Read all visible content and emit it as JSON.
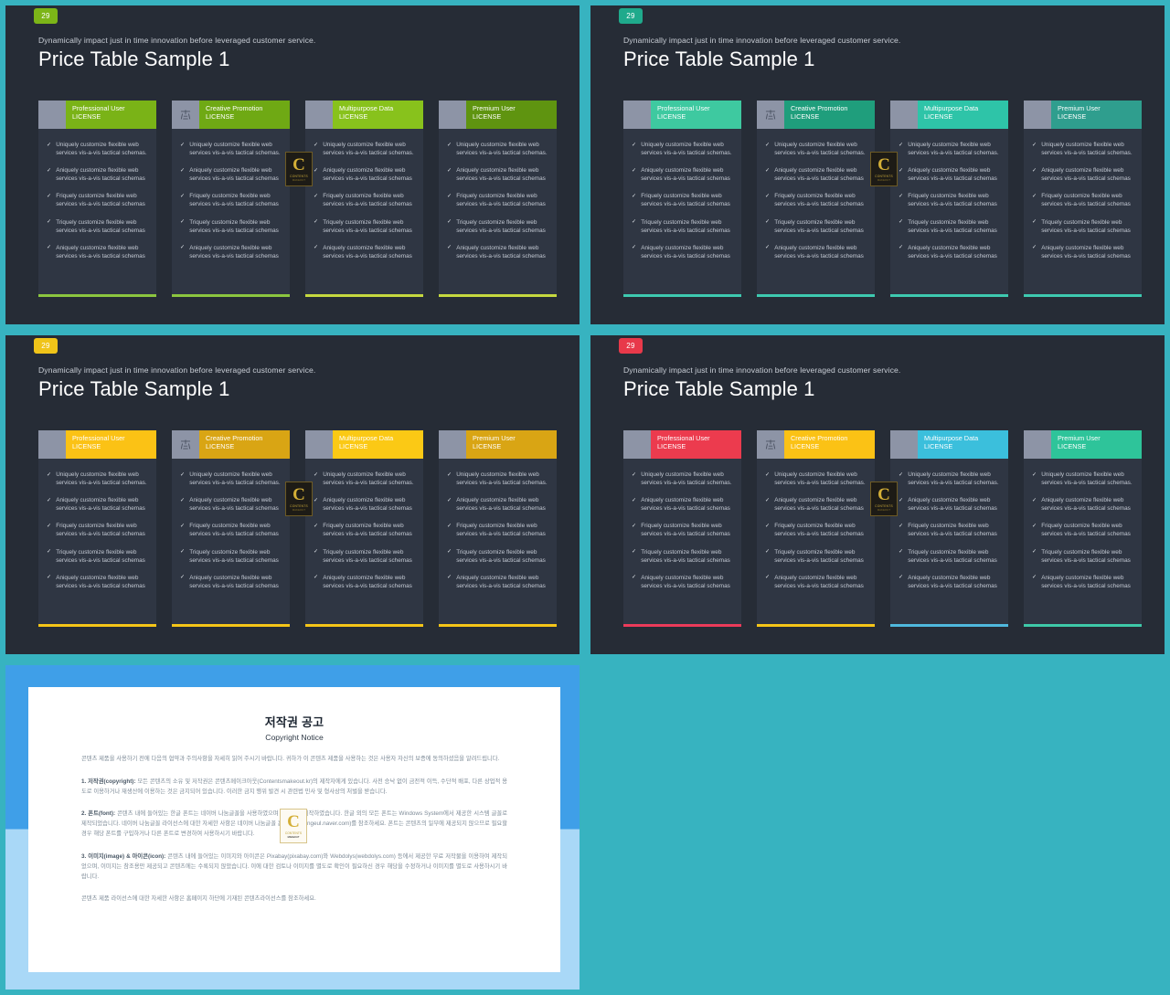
{
  "slides": [
    {
      "badge": {
        "text": "29",
        "color": "#7cb518"
      },
      "kicker": "Dynamically impact just in time innovation  before leveraged customer service.",
      "headline": "Price Table Sample 1",
      "accent_palette": [
        "#7ab317",
        "#6fa914",
        "#88c21c",
        "#5f9410"
      ],
      "rule_palette": [
        "#8cc63f",
        "#8cc63f",
        "#c6d93f",
        "#c6d93f"
      ],
      "cards": [
        {
          "title": "Professional User",
          "subtitle": "LICENSE",
          "icon": "abstract-glyph-icon",
          "icon_visible": false,
          "header_color": "#7ab317",
          "rule_color": "#8cc63f"
        },
        {
          "title": "Creative Promotion",
          "subtitle": "LICENSE",
          "icon": "abstract-glyph-icon",
          "icon_visible": true,
          "header_color": "#6fa914",
          "rule_color": "#8cc63f"
        },
        {
          "title": "Multipurpose Data",
          "subtitle": "LICENSE",
          "icon": "abstract-glyph-icon",
          "icon_visible": false,
          "header_color": "#88c21c",
          "rule_color": "#c6d93f"
        },
        {
          "title": "Premium User",
          "subtitle": "LICENSE",
          "icon": "abstract-glyph-icon",
          "icon_visible": false,
          "header_color": "#5f9410",
          "rule_color": "#c6d93f"
        }
      ]
    },
    {
      "badge": {
        "text": "29",
        "color": "#1faa8c"
      },
      "kicker": "Dynamically impact just in time innovation  before leveraged customer service.",
      "headline": "Price Table Sample 1",
      "accent_palette": [
        "#3ec9a0",
        "#1f9e7c",
        "#2ec4a8",
        "#2f9e8e"
      ],
      "rule_palette": [
        "#3ec9b0",
        "#3ec9b0",
        "#3ec9b0",
        "#3ec9b0"
      ],
      "cards": [
        {
          "title": "Professional User",
          "subtitle": "LICENSE",
          "icon": "abstract-glyph-icon",
          "icon_visible": false,
          "header_color": "#3ec9a0",
          "rule_color": "#3ec9b0"
        },
        {
          "title": "Creative Promotion",
          "subtitle": "LICENSE",
          "icon": "abstract-glyph-icon",
          "icon_visible": true,
          "header_color": "#1f9e7c",
          "rule_color": "#3ec9b0"
        },
        {
          "title": "Multipurpose Data",
          "subtitle": "LICENSE",
          "icon": "abstract-glyph-icon",
          "icon_visible": false,
          "header_color": "#2ec4a8",
          "rule_color": "#3ec9b0"
        },
        {
          "title": "Premium User",
          "subtitle": "LICENSE",
          "icon": "abstract-glyph-icon",
          "icon_visible": false,
          "header_color": "#2f9e8e",
          "rule_color": "#3ec9b0"
        }
      ]
    },
    {
      "badge": {
        "text": "29",
        "color": "#f0c419"
      },
      "kicker": "Dynamically impact just in time innovation  before leveraged customer service.",
      "headline": "Price Table Sample 1",
      "accent_palette": [
        "#fbc215",
        "#d9a514",
        "#fbc915",
        "#d9a514"
      ],
      "rule_palette": [
        "#f5c518",
        "#f5c518",
        "#f5c518",
        "#f5c518"
      ],
      "cards": [
        {
          "title": "Professional User",
          "subtitle": "LICENSE",
          "icon": "abstract-glyph-icon",
          "icon_visible": false,
          "header_color": "#fbc215",
          "rule_color": "#f5c518"
        },
        {
          "title": "Creative Promotion",
          "subtitle": "LICENSE",
          "icon": "abstract-glyph-icon",
          "icon_visible": true,
          "header_color": "#d9a514",
          "rule_color": "#f5c518"
        },
        {
          "title": "Multipurpose Data",
          "subtitle": "LICENSE",
          "icon": "abstract-glyph-icon",
          "icon_visible": false,
          "header_color": "#fbc915",
          "rule_color": "#f5c518"
        },
        {
          "title": "Premium User",
          "subtitle": "LICENSE",
          "icon": "abstract-glyph-icon",
          "icon_visible": false,
          "header_color": "#d9a514",
          "rule_color": "#f5c518"
        }
      ]
    },
    {
      "badge": {
        "text": "29",
        "color": "#e8394a"
      },
      "kicker": "Dynamically impact just in time innovation  before leveraged customer service.",
      "headline": "Price Table Sample 1",
      "accent_palette": [
        "#ec3b4e",
        "#fbc215",
        "#3bbfdc",
        "#2ec49a"
      ],
      "rule_palette": [
        "#ec3b5a",
        "#f5c518",
        "#4fb8de",
        "#3ec9a8"
      ],
      "cards": [
        {
          "title": "Professional User",
          "subtitle": "LICENSE",
          "icon": "abstract-glyph-icon",
          "icon_visible": false,
          "header_color": "#ec3b4e",
          "rule_color": "#ec3b5a"
        },
        {
          "title": "Creative Promotion",
          "subtitle": "LICENSE",
          "icon": "abstract-glyph-icon",
          "icon_visible": true,
          "header_color": "#fbc215",
          "rule_color": "#f5c518"
        },
        {
          "title": "Multipurpose Data",
          "subtitle": "LICENSE",
          "icon": "abstract-glyph-icon",
          "icon_visible": false,
          "header_color": "#3bbfdc",
          "rule_color": "#4fb8de"
        },
        {
          "title": "Premium User",
          "subtitle": "LICENSE",
          "icon": "abstract-glyph-icon",
          "icon_visible": false,
          "header_color": "#2ec49a",
          "rule_color": "#3ec9a8"
        }
      ]
    }
  ],
  "features": [
    "Uniquely customize flexible web services vis-a-vis tactical schemas.",
    "Aniquely customize flexible web services vis-a-vis tactical schemas",
    "Friquely customize flexible web services vis-a-vis tactical schemas",
    "Triquely customize flexible web services vis-a-vis tactical schemas",
    "Aniquely customize flexible web services vis-a-vis tactical schemas"
  ],
  "check_glyph": "✓",
  "watermark": {
    "letter": "C",
    "line1": "CONTENTS",
    "line2": "MAKEOUT"
  },
  "copyright": {
    "title": "저작권 공고",
    "subtitle": "Copyright Notice",
    "paragraphs": [
      "콘텐츠 제품을 사용하기 전에 다음의 협약과 주의사항을 자세히 읽어 주시기 바랍니다. 귀하가 이 콘텐츠 제품을 사용하는 것은 사용자 자신의 보증에 동의하셨음을 알려드립니다.",
      "1. 저작권(copyright): 모든 콘텐츠의 소유 및 저작권은 콘텐츠메이크아웃(Contentsmakeout.kr)의 제작자에게 있습니다. 사전 승낙 없이 금전적 이득, 수단적 배포, 다른 상업적 용도로 이용하거나 재생산에 이용하는 것은 금지되어 있습니다. 이러한 금지 행위 발견 시 관련법 민사 및 형사상의 처벌을 받습니다.",
      "2. 폰트(font): 콘텐츠 내에 들어있는 한글 폰트는 네이버 나눔글꼴을 사용하였으며 네이버가 제작하였습니다. 한글 외의 모든 폰트는 Windows System에서 제공한 시스템 글꼴로 제작되었습니다. 네이버 나눔글꼴 라이선스에 대한 자세한 사항은 네이버 나눔글꼴 홈페이지(hangeul.naver.com)를 참조하세요. 폰트는 콘텐츠의 일부에 제공되지 않으므로 필요할 경우 해당 폰트를 구입하거나 다른 폰트로 변경하여 사용하시기 바랍니다.",
      "3. 이미지(image) & 아이콘(icon): 콘텐츠 내에 들어있는 이미지와 아이콘은 Pixabay(pixabay.com)와 Webdolys(webdolys.com) 등에서 제공한 무료 저작물을 이용하여 제작되었으며, 이미지는 참조용만 제공되고 콘텐츠에는 수록되지 않았습니다. 이에 대한 검토나 이미지를 별도로 확인이 필요하신 경우 해당을 수정하거나 이미지를 별도로 사용하시기 바랍니다.",
      "콘텐츠 제품 라이선스에 대한 자세한 사항은 홈페이지 하단에 기재된 콘텐츠라이선스를 참조하세요."
    ]
  }
}
